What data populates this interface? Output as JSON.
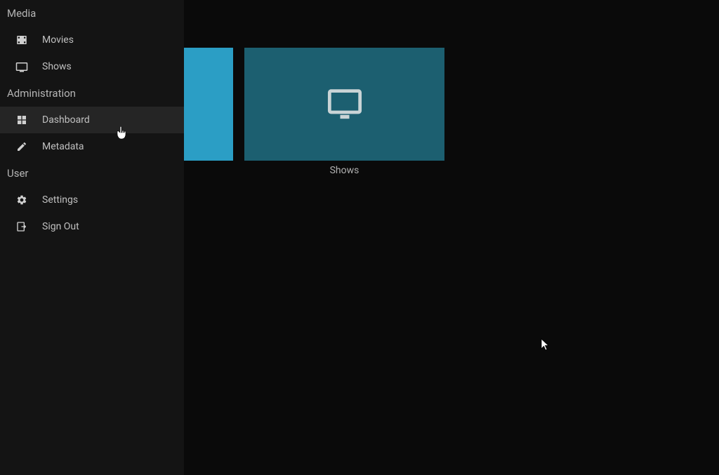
{
  "sidebar": {
    "sections": [
      {
        "header": "Media",
        "items": [
          {
            "icon": "movies",
            "label": "Movies"
          },
          {
            "icon": "tv",
            "label": "Shows"
          }
        ]
      },
      {
        "header": "Administration",
        "items": [
          {
            "icon": "dashboard",
            "label": "Dashboard",
            "active": true
          },
          {
            "icon": "edit",
            "label": "Metadata"
          }
        ]
      },
      {
        "header": "User",
        "items": [
          {
            "icon": "gear",
            "label": "Settings"
          },
          {
            "icon": "signout",
            "label": "Sign Out"
          }
        ]
      }
    ]
  },
  "main": {
    "cards": [
      {
        "label": "Shows",
        "icon": "tv"
      }
    ]
  }
}
